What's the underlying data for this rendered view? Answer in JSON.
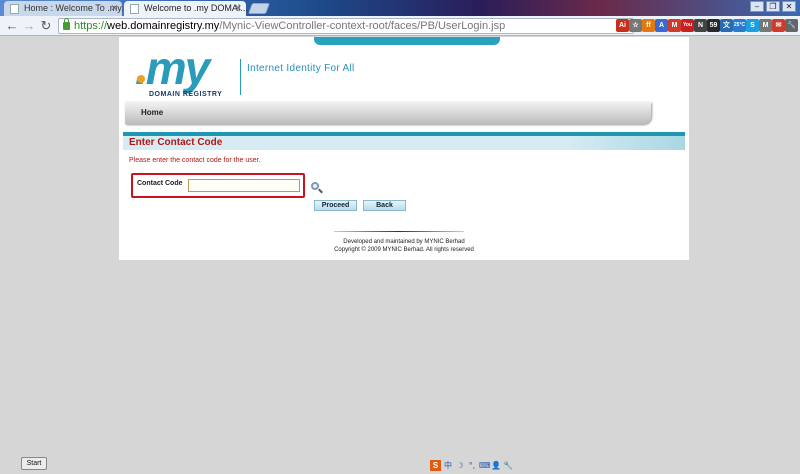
{
  "browser": {
    "tabs": [
      {
        "title": "Home : Welcome To .my...",
        "active": false
      },
      {
        "title": "Welcome to .my DOMAI...",
        "active": true
      }
    ],
    "url": {
      "scheme": "https://",
      "host": "web.domainregistry.my",
      "path": "/Mynic-ViewController-context-root/faces/PB/UserLogin.jsp"
    },
    "extensions": [
      {
        "name": "adobe-extension-icon",
        "glyph": "Ai",
        "color": "#c8301e"
      },
      {
        "name": "star-bookmark-icon",
        "glyph": "☆",
        "color": "#777777"
      },
      {
        "name": "firefox-sync-icon",
        "glyph": "ff",
        "color": "#e07a10"
      },
      {
        "name": "translate-icon",
        "glyph": "A",
        "color": "#3a6ad0"
      },
      {
        "name": "gmail-icon",
        "glyph": "M",
        "color": "#d03a2a"
      },
      {
        "name": "youtube-icon",
        "glyph": "You",
        "color": "#c82020"
      },
      {
        "name": "news-icon",
        "glyph": "N",
        "color": "#444444"
      },
      {
        "name": "counter-badge-icon",
        "glyph": "59",
        "color": "#2a2a2a"
      },
      {
        "name": "dictionary-icon",
        "glyph": "文",
        "color": "#2a6ab0"
      },
      {
        "name": "weather-icon",
        "glyph": "25°C",
        "color": "#2a7ad0"
      },
      {
        "name": "skype-icon",
        "glyph": "S",
        "color": "#1aa0e0"
      },
      {
        "name": "mail-checker-icon",
        "glyph": "M",
        "color": "#777777"
      },
      {
        "name": "mail-alert-icon",
        "glyph": "✉",
        "color": "#d03a2a"
      },
      {
        "name": "settings-wrench-icon",
        "glyph": "🔧",
        "color": "#666666"
      }
    ]
  },
  "site": {
    "logo_text": ".my",
    "logo_sub": "DOMAIN REGISTRY",
    "tagline": "Internet Identity For All",
    "nav": {
      "home": "Home"
    }
  },
  "form": {
    "title": "Enter Contact Code",
    "instruction": "Please enter the contact code for the user.",
    "contact_label": "Contact Code",
    "contact_value": "",
    "proceed_label": "Proceed",
    "back_label": "Back"
  },
  "footer": {
    "developed": "Developed and maintained by MYNIC Berhad",
    "copyright": "Copyright © 2009 MYNIC Berhad. All rights reserved"
  },
  "taskbar": {
    "start_label": "Start",
    "ime_items": [
      "S",
      "中",
      "☽",
      "°,",
      "⌨",
      "👤",
      "🔧"
    ]
  }
}
